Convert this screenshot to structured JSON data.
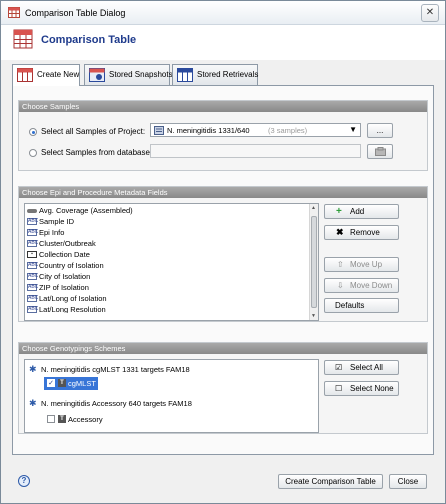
{
  "window": {
    "title": "Comparison Table Dialog",
    "close_glyph": "✕"
  },
  "header": {
    "title": "Comparison Table"
  },
  "tabs": [
    {
      "label": "Create New"
    },
    {
      "label": "Stored Snapshots"
    },
    {
      "label": "Stored Retrievals"
    }
  ],
  "samples": {
    "heading": "Choose Samples",
    "option_project": "Select all Samples of Project:",
    "project_value": "N. meningitidis 1331/640",
    "project_count": "(3 samples)",
    "browse_label": "...",
    "option_database": "Select Samples from database:"
  },
  "fields": {
    "heading": "Choose Epi and Procedure Metadata Fields",
    "items": [
      "Avg. Coverage (Assembled)",
      "Sample ID",
      "Epi Info",
      "Cluster/Outbreak",
      "Collection Date",
      "Country of Isolation",
      "City of Isolation",
      "ZIP of Isolation",
      "Lat/Long of Isolation",
      "Lat/Long Resolution"
    ],
    "add_label": "Add",
    "remove_label": "Remove",
    "move_up_label": "Move Up",
    "move_down_label": "Move Down",
    "defaults_label": "Defaults"
  },
  "genotyping": {
    "heading": "Choose Genotypings Schemes",
    "tree": [
      {
        "label": "N. meningitidis cgMLST 1331 targets FAM18"
      },
      {
        "label": "cgMLST",
        "checked": true
      },
      {
        "label": "N. meningitidis Accessory 640 targets FAM18"
      },
      {
        "label": "Accessory",
        "checked": false
      }
    ],
    "select_all_label": "Select All",
    "select_none_label": "Select None"
  },
  "footer": {
    "help_glyph": "?",
    "create_label": "Create Comparison Table",
    "close_label": "Close"
  },
  "colors": {
    "accent": "#1f3b8c",
    "selection": "#3875d7",
    "header_bar": "#999999"
  }
}
